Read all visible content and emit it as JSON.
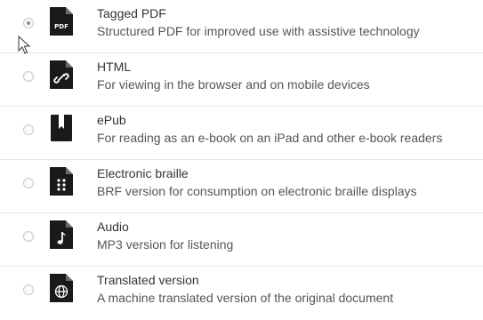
{
  "options": [
    {
      "title": "Tagged PDF",
      "description": "Structured PDF for improved use with assistive technology",
      "icon": "pdf-file-icon",
      "icon_text": "PDF",
      "selected": true
    },
    {
      "title": "HTML",
      "description": "For viewing in the browser and on mobile devices",
      "icon": "html-link-file-icon",
      "selected": false
    },
    {
      "title": "ePub",
      "description": "For reading as an e-book on an iPad and other e-book readers",
      "icon": "epub-book-icon",
      "selected": false
    },
    {
      "title": "Electronic braille",
      "description": "BRF version for consumption on electronic braille displays",
      "icon": "braille-file-icon",
      "selected": false
    },
    {
      "title": "Audio",
      "description": "MP3 version for listening",
      "icon": "audio-file-icon",
      "selected": false
    },
    {
      "title": "Translated version",
      "description": "A machine translated version of the original document",
      "icon": "translated-globe-file-icon",
      "selected": false
    }
  ],
  "colors": {
    "icon": "#1a1a1a",
    "title": "#333333",
    "description": "#555555",
    "divider": "#e6e6e6"
  }
}
